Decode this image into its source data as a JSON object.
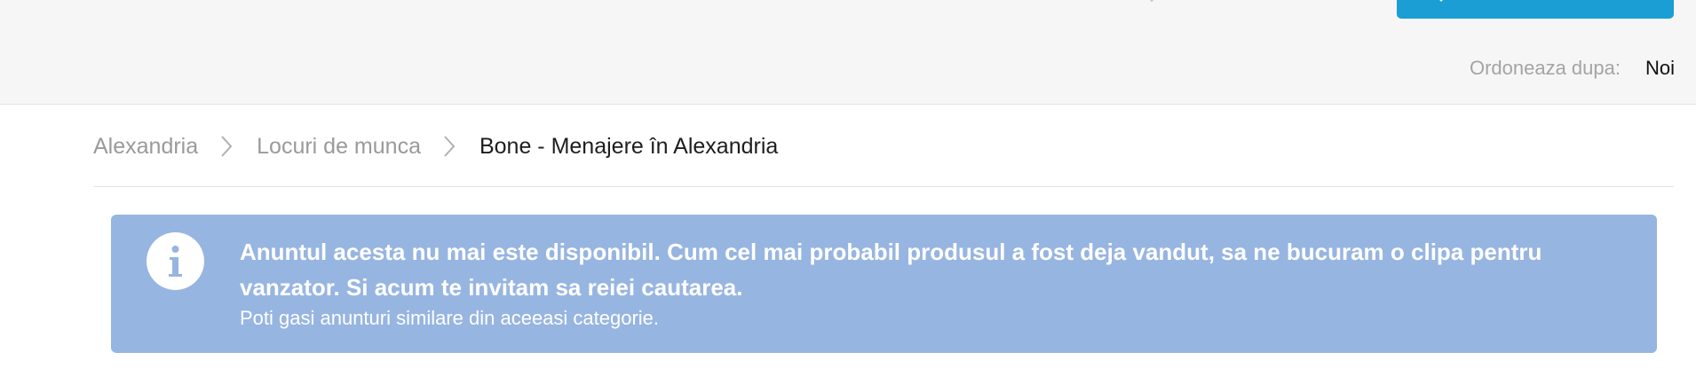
{
  "header": {
    "clear_icon": "close-icon",
    "search_icon": "search-icon",
    "search_button_color": "#1a9ed4",
    "sort_label": "Ordoneaza dupa:",
    "sort_value": "Noi"
  },
  "breadcrumb": {
    "items": [
      "Alexandria",
      "Locuri de munca"
    ],
    "current": "Bone - Menajere în Alexandria",
    "separator_icon": "chevron-right-icon"
  },
  "alert": {
    "icon": "info-icon",
    "background_color": "#97b5e1",
    "message": "Anuntul acesta nu mai este disponibil. Cum cel mai probabil produsul a fost deja vandut, sa ne bucuram o clipa pentru vanzator. Si acum te invitam sa reiei cautarea.",
    "sub_message": "Poti gasi anunturi similare din aceeasi categorie."
  }
}
